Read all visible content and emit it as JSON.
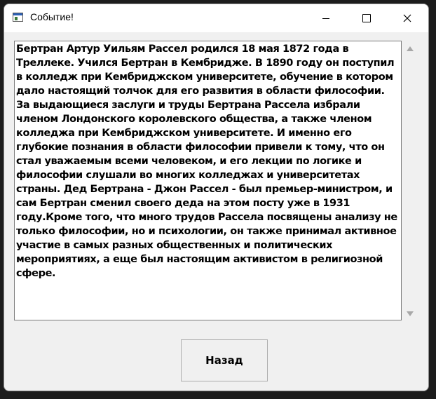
{
  "window": {
    "title": "Событие!",
    "app_icon": "window-app-icon",
    "controls": [
      "minimize-icon",
      "maximize-icon",
      "close-icon"
    ]
  },
  "textbox": {
    "text": "Бертран Артур Уильям Рассел родился 18 мая 1872 года в Треллеке. Учился Бертран в Кембридже. В 1890 году он поступил в колледж при Кембриджском университете, обучение в котором дало настоящий толчок для его развития в области философии. За выдающиеся заслуги и труды Бертрана Рассела избрали членом Лондонского королевского общества, а также членом колледжа при Кембриджском университете. И именно его глубокие познания в области философии привели к тому, что он стал уважаемым всеми человеком, и его лекции по логике и философии слушали во многих колледжах и университетах страны. Дед Бертрана - Джон Рассел - был премьер-министром, и сам Бертран сменил своего деда на этом посту уже в 1931 году.Кроме того, что много трудов Рассела посвящены анализу не только философии, но и психологии, он также принимал активное участие в самых разных общественных и политических мероприятиях, а еще был настоящим активистом в религиозной сфере."
  },
  "buttons": {
    "back_label": "Назад"
  },
  "colors": {
    "titlebar": "#ffffff",
    "window_bg": "#f0f0f0",
    "text": "#000000"
  }
}
